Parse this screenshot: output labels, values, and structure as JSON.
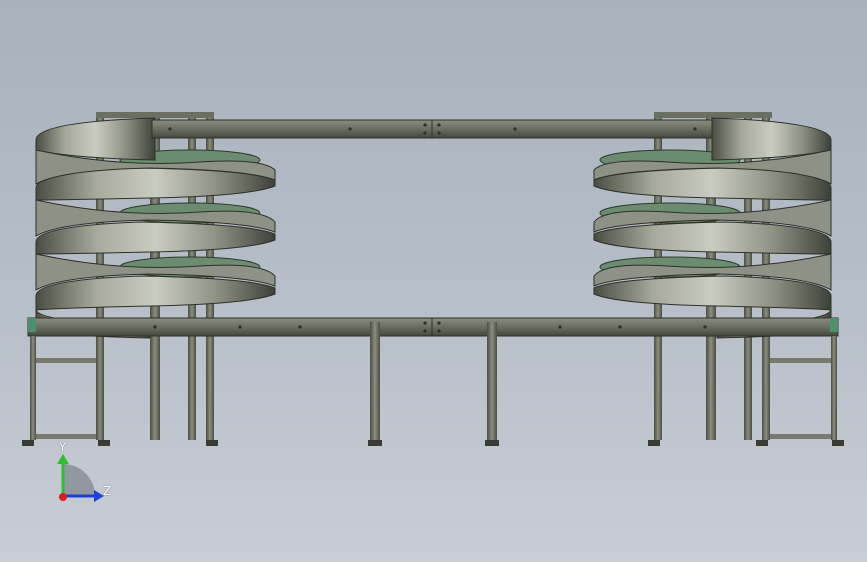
{
  "view": {
    "background_top": "#a9b1bd",
    "background_bottom": "#c8cdd4"
  },
  "model": {
    "frame_color": "#6f7468",
    "frame_dark": "#3d4038",
    "spiral_color": "#8b8f83",
    "conveyor_accent": "#4f8f6f",
    "left_spiral_turns": 4,
    "right_spiral_turns": 4
  },
  "triad": {
    "y_label": "Y",
    "z_label": "Z",
    "y_color": "#2fbf2f",
    "z_color": "#1f3fd8",
    "x_color": "#d81f1f",
    "icon": "coordinate-triad-icon"
  }
}
